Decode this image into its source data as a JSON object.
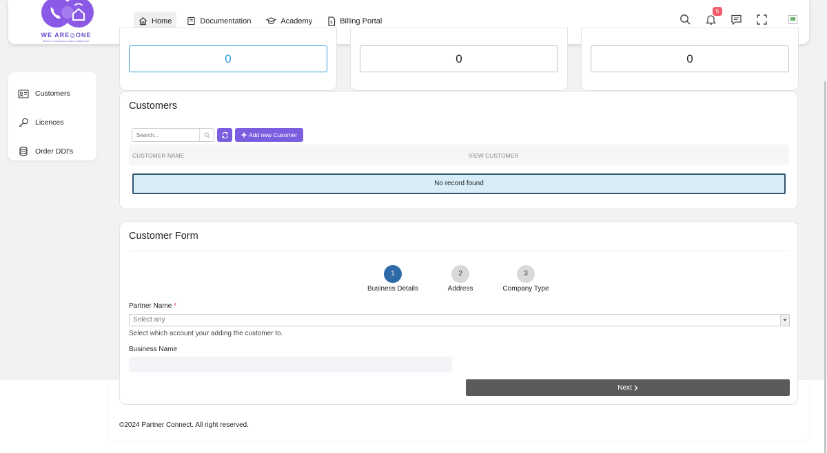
{
  "logo": {
    "brand": "WE ARE◎ONE",
    "tagline": "Where connections make a difference"
  },
  "nav": [
    {
      "label": "Home",
      "icon": "home-icon",
      "active": true
    },
    {
      "label": "Documentation",
      "icon": "book-icon",
      "active": false
    },
    {
      "label": "Academy",
      "icon": "graduation-cap-icon",
      "active": false
    },
    {
      "label": "Billing Portal",
      "icon": "invoice-icon",
      "active": false
    }
  ],
  "header": {
    "notification_count": "5"
  },
  "sidebar": [
    {
      "label": "Customers",
      "icon": "id-card-icon"
    },
    {
      "label": "Licences",
      "icon": "key-icon"
    },
    {
      "label": "Order DDI's",
      "icon": "database-icon"
    }
  ],
  "stats": [
    {
      "value": "0",
      "highlight": true
    },
    {
      "value": "0",
      "highlight": false
    },
    {
      "value": "0",
      "highlight": false
    }
  ],
  "customers": {
    "title": "Customers",
    "search_placeholder": "Search...",
    "add_label": "Add new Cusomer",
    "columns": [
      "CUSTOMER NAME",
      "VIEW CUSTOMER"
    ],
    "empty_message": "No record found"
  },
  "form": {
    "title": "Customer Form",
    "steps": [
      {
        "number": "1",
        "label": "Business Details",
        "active": true
      },
      {
        "number": "2",
        "label": "Address",
        "active": false
      },
      {
        "number": "3",
        "label": "Company Type",
        "active": false
      }
    ],
    "partner_label": "Partner Name",
    "required_mark": "*",
    "partner_placeholder": "Select any",
    "partner_help": "Select which account your adding the customer to.",
    "business_label": "Business Name",
    "business_value": "",
    "next_label": "Next"
  },
  "footer": {
    "text": "©2024 Partner Connect. All right reserved."
  },
  "colors": {
    "accent": "#7b5ee0",
    "step_active": "#2f6aa8",
    "badge": "#f25c6b",
    "info_bg": "#d8edf7"
  }
}
